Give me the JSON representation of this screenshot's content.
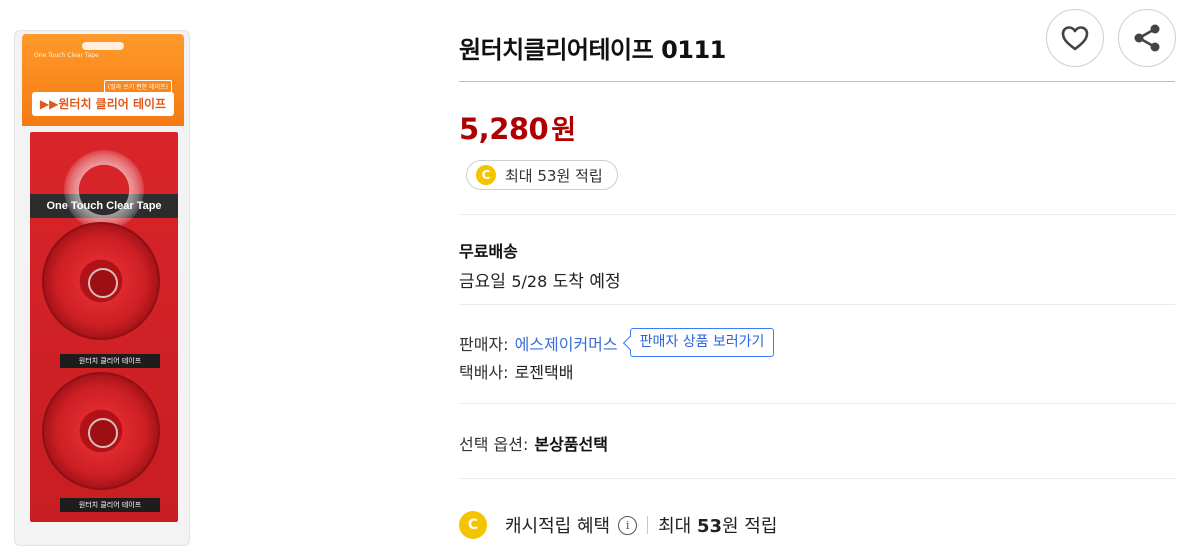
{
  "product": {
    "title": "원터치클리어테이프 0111",
    "image": {
      "package_small_text": "One Touch Clear Tape",
      "package_sub_text": "(잘라 쓰기 편한 테이프)",
      "package_title": "▶▶원터치 클리어 테이프",
      "band_text": "One Touch Clear Tape",
      "strip_text_1": "원터치 클리어 테이프",
      "strip_text_2": "원터치 클리어 테이프"
    }
  },
  "actions": {
    "wishlist_icon": "heart-outline",
    "share_icon": "share-nodes"
  },
  "price": {
    "amount": "5,280",
    "unit": "원",
    "color": "#ae0000"
  },
  "reward": {
    "coin_glyph": "C",
    "text": "최대 53원 적립"
  },
  "shipping": {
    "title": "무료배송",
    "day": "금요일",
    "date": "5/28",
    "suffix": "도착 예정"
  },
  "seller": {
    "label": "판매자:",
    "name": "에스제이커머스",
    "button": "판매자 상품 보러가기",
    "link_color": "#3b6fd6"
  },
  "courier": {
    "label": "택배사:",
    "name": "로젠택배"
  },
  "option": {
    "label": "선택 옵션:",
    "value": "본상품선택"
  },
  "cash_benefit": {
    "coin_glyph": "C",
    "title": "캐시적립 혜택",
    "info_glyph": "i",
    "prefix": "최대",
    "amount": "53",
    "suffix": "원 적립"
  }
}
